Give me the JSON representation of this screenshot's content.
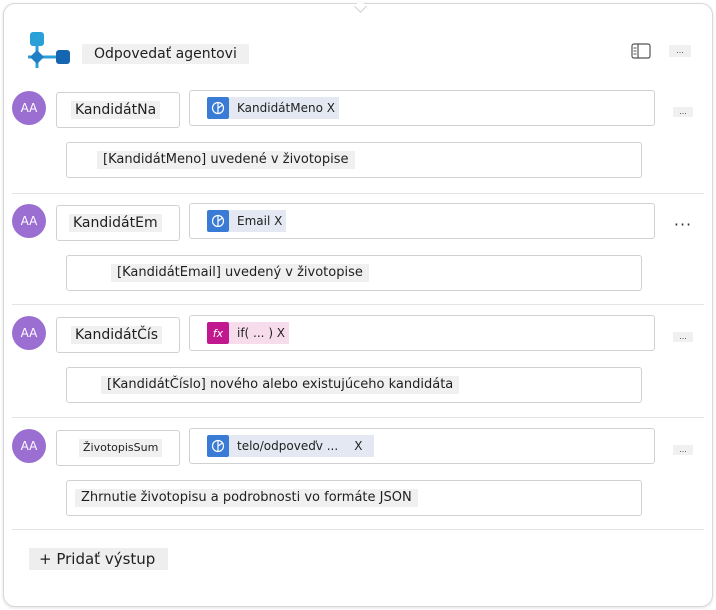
{
  "header": {
    "title": "Odpovedať agentovi",
    "more_label": "..."
  },
  "outputs": [
    {
      "avatar": "AA",
      "name": "KandidátNa",
      "value_icon": "data-variable-icon",
      "value_label": "KandidátMeno X",
      "value_x": "",
      "description": "[KandidátMeno] uvedené v životopise",
      "more_label": "..."
    },
    {
      "avatar": "AA",
      "name": "KandidátEm",
      "value_icon": "data-variable-icon",
      "value_label": "Email X",
      "value_x": "",
      "description": "[KandidátEmail] uvedený v životopise",
      "more_label": "···"
    },
    {
      "avatar": "AA",
      "name": "KandidátČís",
      "value_icon": "fx-formula-icon",
      "value_icon_text": "fx",
      "value_label": "if( ... ) X",
      "value_x": "",
      "description": "[KandidátČíslo] nového alebo existujúceho kandidáta",
      "more_label": "..."
    },
    {
      "avatar": "AA",
      "name": "ŽivotopisSum",
      "value_icon": "data-variable-icon",
      "value_label": "telo/odpoveďv ...",
      "value_x": "X",
      "description": "Zhrnutie životopisu a podrobnosti vo formáte JSON",
      "more_label": "..."
    }
  ],
  "footer": {
    "add_output_label": "+ Pridať výstup"
  },
  "colors": {
    "avatar": "#9b6fd1",
    "variable_icon": "#3a7bd5",
    "formula_icon": "#c2188f"
  }
}
